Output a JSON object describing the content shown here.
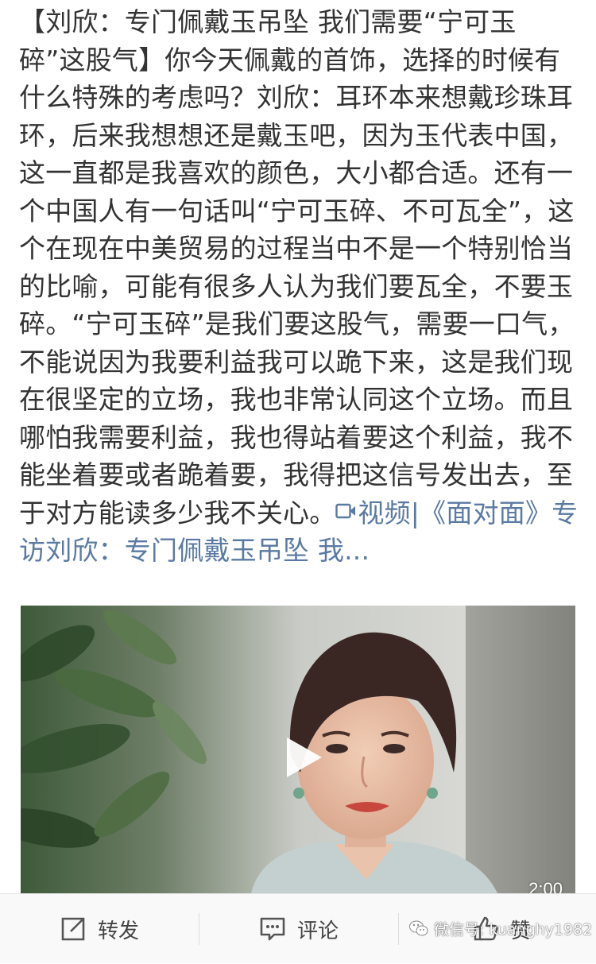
{
  "post": {
    "body_text": "【刘欣：专门佩戴玉吊坠 我们需要“宁可玉碎”这股气】你今天佩戴的首饰，选择的时候有什么特殊的考虑吗？刘欣：耳环本来想戴珍珠耳环，后来我想想还是戴玉吧，因为玉代表中国，这一直都是我喜欢的颜色，大小都合适。还有一个中国人有一句话叫“宁可玉碎、不可瓦全”，这个在现在中美贸易的过程当中不是一个特别恰当的比喻，可能有很多人认为我们要瓦全，不要玉碎。“宁可玉碎”是我们要这股气，需要一口气，不能说因为我要利益我可以跪下来，这是我们现在很坚定的立场，我也非常认同这个立场。而且哪怕我需要利益，我也得站着要这个利益，我不能坐着要或者跪着要，我得把这信号发出去，至于对方能读多少我不关心。",
    "link_icon": "video-link-icon",
    "link_text": "视频|《面对面》专访刘欣：专门佩戴玉吊坠 我..."
  },
  "video": {
    "duration": "2:00",
    "play_icon": "play-icon"
  },
  "actions": {
    "forward_label": "转发",
    "forward_icon": "share-icon",
    "comment_label": "评论",
    "comment_icon": "comment-icon",
    "like_label": "赞",
    "like_icon": "thumbs-up-icon"
  },
  "watermark": {
    "text": "微信号: kuanghy1982",
    "icon": "wechat-icon"
  },
  "colors": {
    "body_text": "#333333",
    "link": "#5a7aa3",
    "action_bar_bg": "#f9f9f9"
  }
}
